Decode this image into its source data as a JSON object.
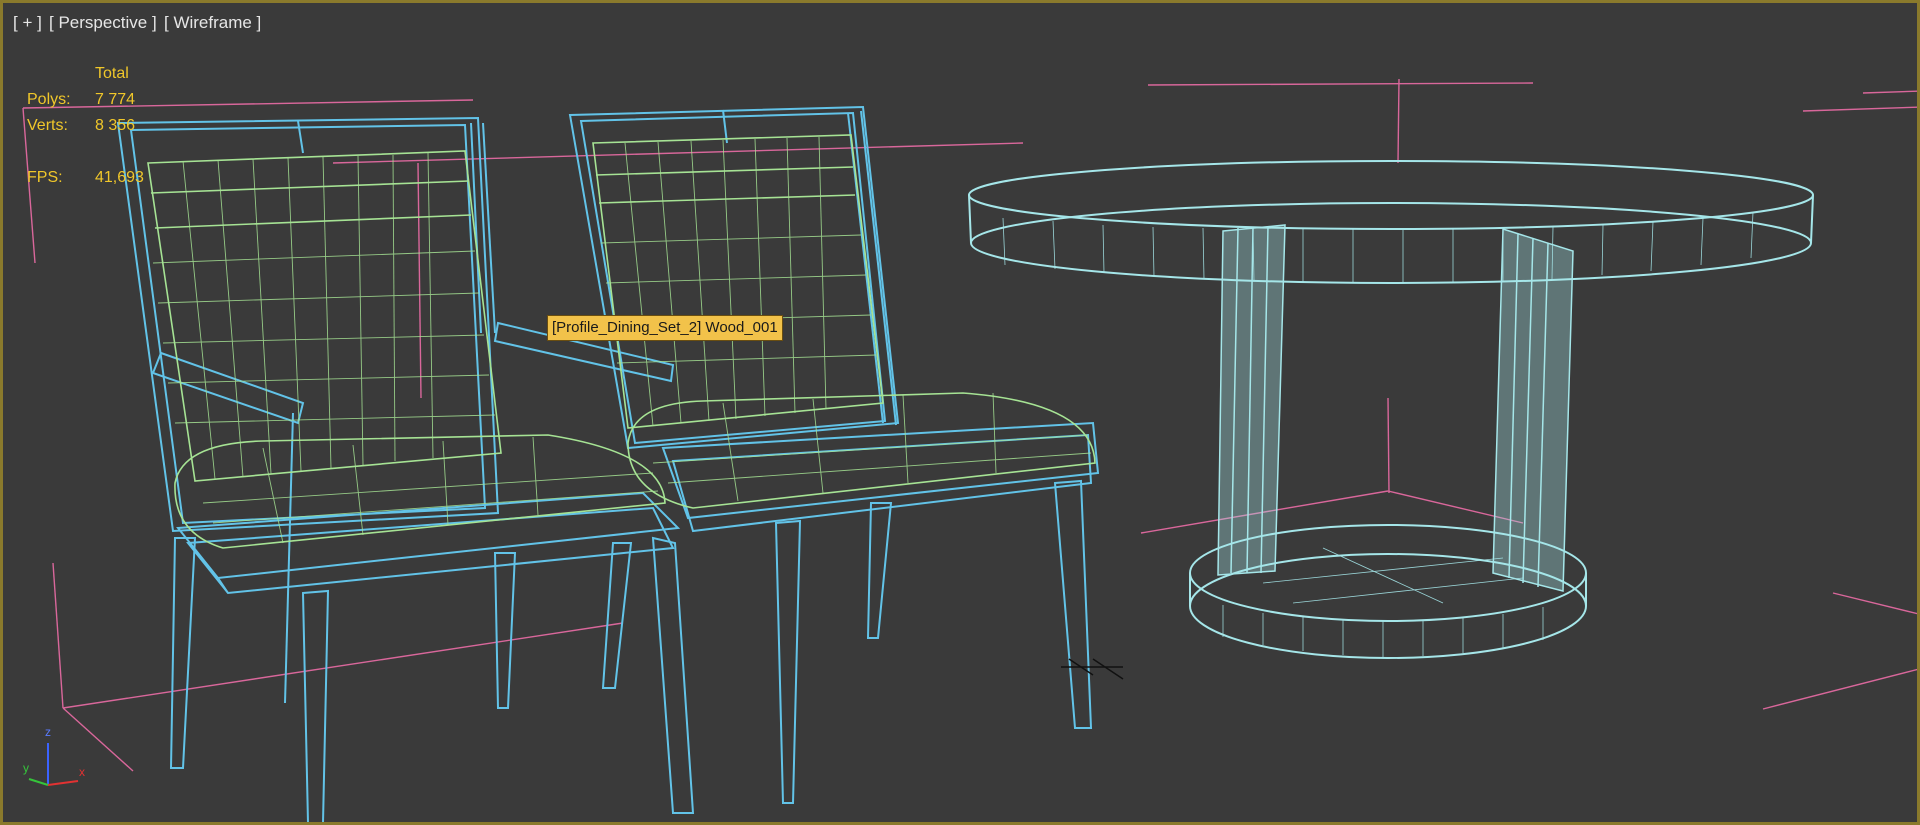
{
  "viewport": {
    "labels": [
      "[ + ]",
      "[ Perspective ]",
      "[ Wireframe ]"
    ],
    "border_color": "#8a7a2c",
    "background_color": "#3a3a3a"
  },
  "stats": {
    "header": "Total",
    "polys_label": "Polys:",
    "polys_value": "7 774",
    "verts_label": "Verts:",
    "verts_value": "8 356",
    "fps_label": "FPS:",
    "fps_value": "41,693",
    "color": "#f0c72a"
  },
  "tooltip": {
    "text": "[Profile_Dining_Set_2] Wood_001"
  },
  "objects": [
    {
      "name": "chair-with-armrests",
      "wire_colors": [
        "#62c3e8",
        "#a6e394"
      ]
    },
    {
      "name": "chair",
      "wire_colors": [
        "#62c3e8",
        "#a6e394"
      ]
    },
    {
      "name": "round-table",
      "wire_colors": [
        "#a5e6e9"
      ]
    }
  ],
  "axis_gizmo": {
    "x_label": "x",
    "y_label": "y",
    "z_label": "z"
  },
  "colors": {
    "frame_lines": "#d9679b",
    "chair_frame": "#62c3e8",
    "cushion": "#a6e394",
    "table": "#a5e6e9"
  }
}
